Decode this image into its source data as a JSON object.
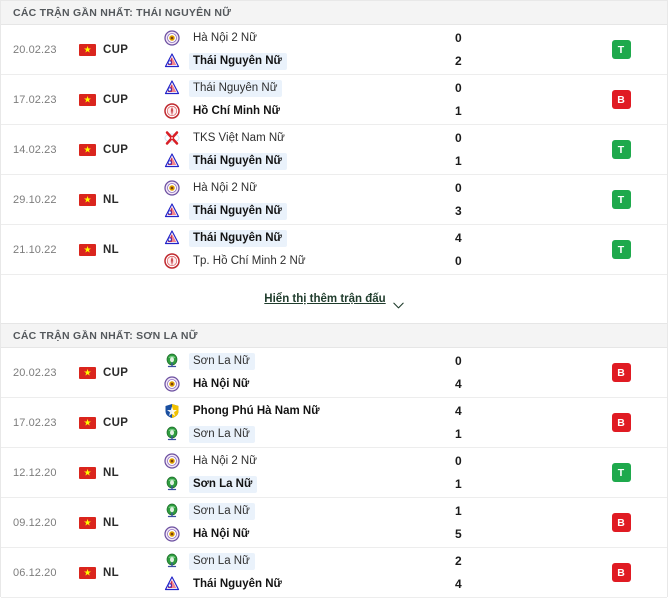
{
  "sections": [
    {
      "id": "section-thai-nguyen",
      "header": "CÁC TRẬN GẦN NHẤT: THÁI NGUYÊN NỮ",
      "focus_team": "Thái Nguyên Nữ",
      "matches": [
        {
          "date": "20.02.23",
          "country_flag": "vietnam-flag",
          "competition": "CUP",
          "home": {
            "name": "Hà Nội 2 Nữ",
            "logo": "hanoi2-logo",
            "score": "0",
            "bold": false,
            "highlight": false
          },
          "away": {
            "name": "Thái Nguyên Nữ",
            "logo": "thainguyen-logo",
            "score": "2",
            "bold": true,
            "highlight": true
          },
          "result": {
            "letter": "T",
            "type": "win"
          }
        },
        {
          "date": "17.02.23",
          "country_flag": "vietnam-flag",
          "competition": "CUP",
          "home": {
            "name": "Thái Nguyên Nữ",
            "logo": "thainguyen-logo",
            "score": "0",
            "bold": false,
            "highlight": true
          },
          "away": {
            "name": "Hồ Chí Minh Nữ",
            "logo": "hochiminh-logo",
            "score": "1",
            "bold": true,
            "highlight": false
          },
          "result": {
            "letter": "B",
            "type": "loss"
          }
        },
        {
          "date": "14.02.23",
          "country_flag": "vietnam-flag",
          "competition": "CUP",
          "home": {
            "name": "TKS Việt Nam Nữ",
            "logo": "tks-logo",
            "score": "0",
            "bold": false,
            "highlight": false
          },
          "away": {
            "name": "Thái Nguyên Nữ",
            "logo": "thainguyen-logo",
            "score": "1",
            "bold": true,
            "highlight": true
          },
          "result": {
            "letter": "T",
            "type": "win"
          }
        },
        {
          "date": "29.10.22",
          "country_flag": "vietnam-flag",
          "competition": "NL",
          "home": {
            "name": "Hà Nội 2 Nữ",
            "logo": "hanoi2-logo",
            "score": "0",
            "bold": false,
            "highlight": false
          },
          "away": {
            "name": "Thái Nguyên Nữ",
            "logo": "thainguyen-logo",
            "score": "3",
            "bold": true,
            "highlight": true
          },
          "result": {
            "letter": "T",
            "type": "win"
          }
        },
        {
          "date": "21.10.22",
          "country_flag": "vietnam-flag",
          "competition": "NL",
          "home": {
            "name": "Thái Nguyên Nữ",
            "logo": "thainguyen-logo",
            "score": "4",
            "bold": true,
            "highlight": true
          },
          "away": {
            "name": "Tp. Hồ Chí Minh 2 Nữ",
            "logo": "hochiminh2-logo",
            "score": "0",
            "bold": false,
            "highlight": false
          },
          "result": {
            "letter": "T",
            "type": "win"
          }
        }
      ],
      "show_more": "Hiển thị thêm trận đấu"
    },
    {
      "id": "section-son-la",
      "header": "CÁC TRẬN GẦN NHẤT: SƠN LA NỮ",
      "focus_team": "Sơn La Nữ",
      "matches": [
        {
          "date": "20.02.23",
          "country_flag": "vietnam-flag",
          "competition": "CUP",
          "home": {
            "name": "Sơn La Nữ",
            "logo": "sonla-logo",
            "score": "0",
            "bold": false,
            "highlight": true
          },
          "away": {
            "name": "Hà Nội Nữ",
            "logo": "hanoi-logo",
            "score": "4",
            "bold": true,
            "highlight": false
          },
          "result": {
            "letter": "B",
            "type": "loss"
          }
        },
        {
          "date": "17.02.23",
          "country_flag": "vietnam-flag",
          "competition": "CUP",
          "home": {
            "name": "Phong Phú Hà Nam Nữ",
            "logo": "phongphu-logo",
            "score": "4",
            "bold": true,
            "highlight": false
          },
          "away": {
            "name": "Sơn La Nữ",
            "logo": "sonla-logo",
            "score": "1",
            "bold": false,
            "highlight": true
          },
          "result": {
            "letter": "B",
            "type": "loss"
          }
        },
        {
          "date": "12.12.20",
          "country_flag": "vietnam-flag",
          "competition": "NL",
          "home": {
            "name": "Hà Nội 2 Nữ",
            "logo": "hanoi2-logo",
            "score": "0",
            "bold": false,
            "highlight": false
          },
          "away": {
            "name": "Sơn La Nữ",
            "logo": "sonla-logo",
            "score": "1",
            "bold": true,
            "highlight": true
          },
          "result": {
            "letter": "T",
            "type": "win"
          }
        },
        {
          "date": "09.12.20",
          "country_flag": "vietnam-flag",
          "competition": "NL",
          "home": {
            "name": "Sơn La Nữ",
            "logo": "sonla-logo",
            "score": "1",
            "bold": false,
            "highlight": true
          },
          "away": {
            "name": "Hà Nội Nữ",
            "logo": "hanoi-logo",
            "score": "5",
            "bold": true,
            "highlight": false
          },
          "result": {
            "letter": "B",
            "type": "loss"
          }
        },
        {
          "date": "06.12.20",
          "country_flag": "vietnam-flag",
          "competition": "NL",
          "home": {
            "name": "Sơn La Nữ",
            "logo": "sonla-logo",
            "score": "2",
            "bold": false,
            "highlight": true
          },
          "away": {
            "name": "Thái Nguyên Nữ",
            "logo": "thainguyen-logo",
            "score": "4",
            "bold": true,
            "highlight": false
          },
          "result": {
            "letter": "B",
            "type": "loss"
          }
        }
      ],
      "show_more": null
    }
  ],
  "colors": {
    "win": "#1ea94c",
    "loss": "#e01b23",
    "header_bg": "#f4f4f4",
    "highlight_bg": "#eaf2fb",
    "flag_red": "#da251d",
    "flag_star": "#ffff00"
  },
  "icons": {
    "chevron_down": "chevron-down-icon",
    "star": "★"
  }
}
